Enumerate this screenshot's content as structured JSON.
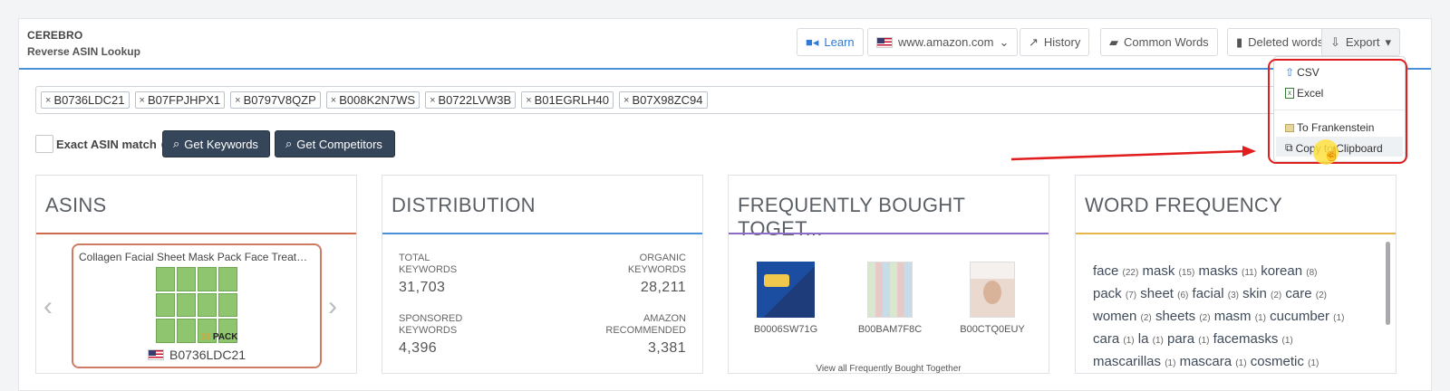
{
  "header": {
    "title": "CEREBRO",
    "subtitle": "Reverse ASIN Lookup"
  },
  "toolbar": {
    "learn": "Learn",
    "domain": "www.amazon.com",
    "history": "History",
    "common_words": "Common Words",
    "deleted_words": "Deleted words",
    "export": "Export"
  },
  "asin_input": {
    "tags": [
      "B0736LDC21",
      "B07FPJHPX1",
      "B0797V8QZP",
      "B008K2N7WS",
      "B0722LVW3B",
      "B01EGRLH40",
      "B07X98ZC94"
    ]
  },
  "controls": {
    "exact_match": "Exact ASIN match",
    "get_keywords": "Get Keywords",
    "get_competitors": "Get Competitors"
  },
  "asins_card": {
    "title": "ASINS",
    "product_title": "Collagen Facial Sheet Mask Pack Face Treatme...",
    "pack_number": "10",
    "pack_label": "PACK",
    "asin": "B0736LDC21"
  },
  "distribution": {
    "title": "DISTRIBUTION",
    "total_label_1": "TOTAL",
    "total_label_2": "KEYWORDS",
    "total_value": "31,703",
    "organic_label_1": "ORGANIC",
    "organic_label_2": "KEYWORDS",
    "organic_value": "28,211",
    "sponsored_label_1": "SPONSORED",
    "sponsored_label_2": "KEYWORDS",
    "sponsored_value": "4,396",
    "amazon_label_1": "AMAZON",
    "amazon_label_2": "RECOMMENDED",
    "amazon_value": "3,381"
  },
  "fbt": {
    "title": "FREQUENTLY BOUGHT TOGET...",
    "items": [
      "B0006SW71G",
      "B00BAM7F8C",
      "B00CTQ0EUY"
    ],
    "view_all": "View all Frequently Bought Together"
  },
  "word_frequency": {
    "title": "WORD FREQUENCY",
    "lines": [
      [
        [
          "face",
          "(22)"
        ],
        [
          "mask",
          "(15)"
        ],
        [
          "masks",
          "(11)"
        ],
        [
          "korean",
          "(8)"
        ]
      ],
      [
        [
          "pack",
          "(7)"
        ],
        [
          "sheet",
          "(6)"
        ],
        [
          "facial",
          "(3)"
        ],
        [
          "skin",
          "(2)"
        ],
        [
          "care",
          "(2)"
        ]
      ],
      [
        [
          "women",
          "(2)"
        ],
        [
          "sheets",
          "(2)"
        ],
        [
          "masm",
          "(1)"
        ],
        [
          "cucumber",
          "(1)"
        ]
      ],
      [
        [
          "cara",
          "(1)"
        ],
        [
          "la",
          "(1)"
        ],
        [
          "para",
          "(1)"
        ],
        [
          "facemasks",
          "(1)"
        ]
      ],
      [
        [
          "mascarillas",
          "(1)"
        ],
        [
          "mascara",
          "(1)"
        ],
        [
          "cosmetic",
          "(1)"
        ]
      ]
    ]
  },
  "export_menu": {
    "csv": "CSV",
    "excel": "Excel",
    "frankenstein": "To Frankenstein",
    "clipboard": "Copy to Clipboard"
  },
  "colors": {
    "accent_blue": "#4a90d9",
    "dark_button": "#36465a",
    "highlight_red": "#e11d1d"
  }
}
